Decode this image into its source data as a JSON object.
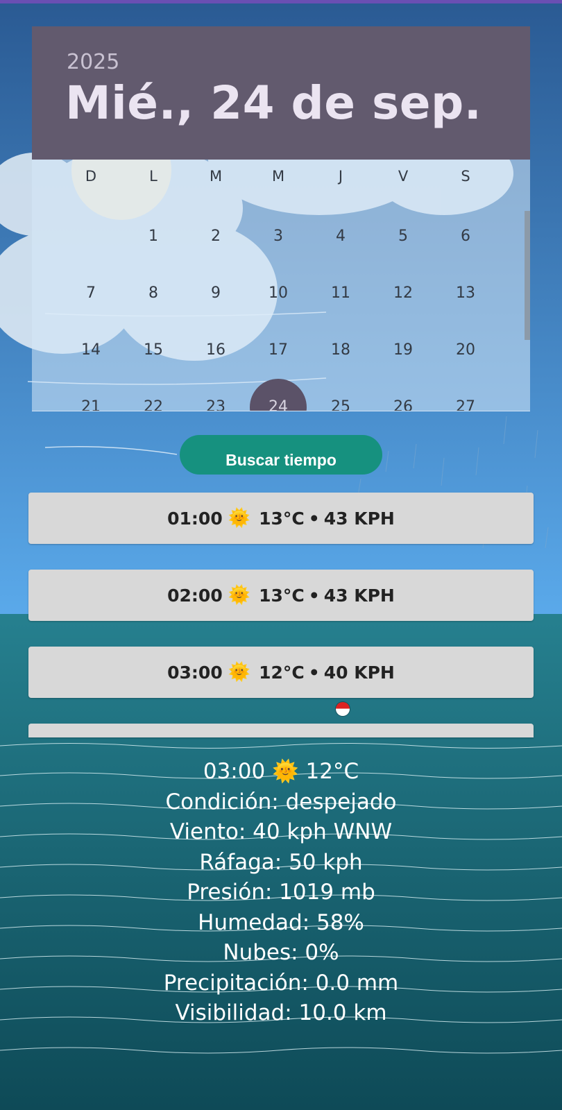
{
  "picker": {
    "year": "2025",
    "date_label": "Mié., 24 de sep.",
    "weekdays": [
      "D",
      "L",
      "M",
      "M",
      "J",
      "V",
      "S"
    ],
    "weeks": [
      [
        "",
        "1",
        "2",
        "3",
        "4",
        "5",
        "6"
      ],
      [
        "7",
        "8",
        "9",
        "10",
        "11",
        "12",
        "13"
      ],
      [
        "14",
        "15",
        "16",
        "17",
        "18",
        "19",
        "20"
      ],
      [
        "21",
        "22",
        "23",
        "24",
        "25",
        "26",
        "27"
      ]
    ],
    "selected_day": "24"
  },
  "search_button_label": "Buscar tiempo",
  "hours": [
    {
      "time": "01:00",
      "icon": "sun-icon",
      "glyph": "🌞",
      "temp": "13°C",
      "wind": "43 KPH"
    },
    {
      "time": "02:00",
      "icon": "sun-icon",
      "glyph": "🌞",
      "temp": "13°C",
      "wind": "43 KPH"
    },
    {
      "time": "03:00",
      "icon": "sun-icon",
      "glyph": "🌞",
      "temp": "12°C",
      "wind": "40 KPH"
    }
  ],
  "details": {
    "time": "03:00",
    "glyph": "🌞",
    "temp": "12°C",
    "condicion": "Condición: despejado",
    "viento": "Viento: 40 kph WNW",
    "rafaga": "Ráfaga: 50 kph",
    "presion": "Presión: 1019 mb",
    "humedad": "Humedad: 58%",
    "nubes": "Nubes: 0%",
    "precipitacion": "Precipitación: 0.0 mm",
    "visibilidad": "Visibilidad: 10.0 km"
  },
  "colors": {
    "sky_top": "#2a5a93",
    "sky_bottom": "#5aa9ea",
    "sea_top": "#26808f",
    "sea_bottom": "#0e4a57",
    "header": "#625a6e",
    "button": "#16917f",
    "row": "#d8d8d8"
  }
}
